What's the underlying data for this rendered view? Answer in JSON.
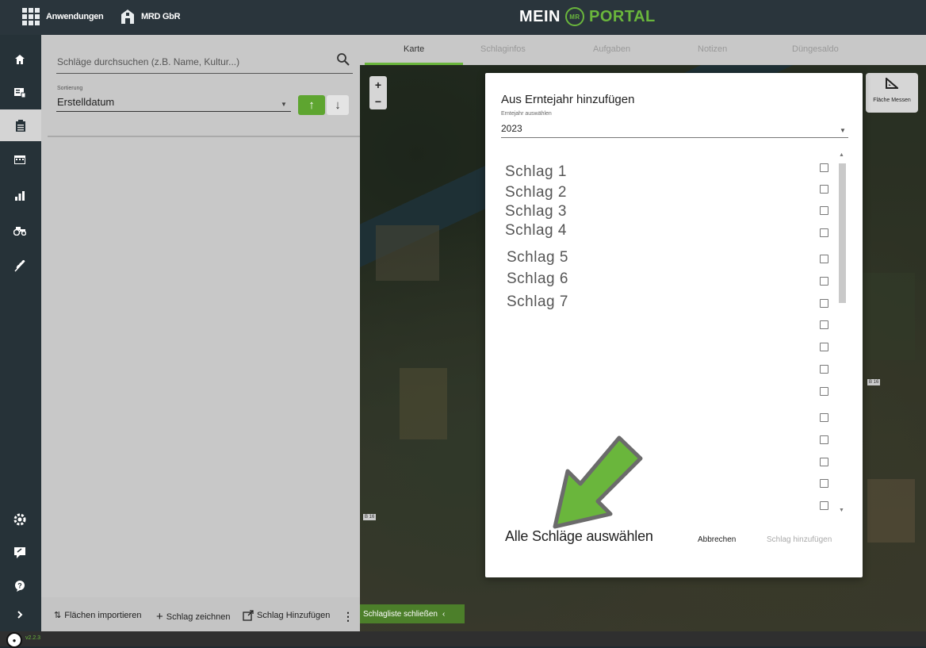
{
  "header": {
    "apps_label": "Anwendungen",
    "org_label": "MRD GbR",
    "brand_left": "MEIN",
    "brand_logo": "MR",
    "brand_right": "PORTAL"
  },
  "sidebar": {
    "icons": [
      "home-icon",
      "map-list-icon",
      "clipboard-icon",
      "calendar-icon",
      "bar-chart-icon",
      "tractor-icon",
      "wheat-icon",
      "settings-icon",
      "feedback-icon",
      "help-icon",
      "expand-icon"
    ]
  },
  "left_panel": {
    "search_placeholder": "Schläge durchsuchen (z.B. Name, Kultur...)",
    "sort_label": "Sortierung",
    "sort_value": "Erstelldatum",
    "sort_asc": "↑",
    "sort_desc": "↓",
    "actions": {
      "import": "Flächen importieren",
      "draw": "Schlag zeichnen",
      "add": "Schlag Hinzufügen"
    }
  },
  "tabs": [
    "Karte",
    "Schlaginfos",
    "Aufgaben",
    "Notizen",
    "Düngesaldo"
  ],
  "map": {
    "zoom_in": "+",
    "zoom_out": "−",
    "measure_label": "Fläche Messen",
    "close_list": "Schlagliste schließen",
    "road_labels": [
      "B 16",
      "B 16"
    ]
  },
  "dialog": {
    "title": "Aus Erntejahr hinzufügen",
    "year_label": "Erntejahr auswählen",
    "year_value": "2023",
    "items": [
      "Schlag 1",
      "Schlag 2",
      "Schlag 3",
      "Schlag 4",
      "Schlag 5",
      "Schlag 6",
      "Schlag 7"
    ],
    "select_all": "Alle Schläge auswählen",
    "cancel": "Abbrechen",
    "add": "Schlag hinzufügen"
  },
  "footer": {
    "version": "v2.2.3"
  },
  "colors": {
    "accent": "#6ab63c",
    "accent_dark": "#5ea530",
    "sidebar": "#263238"
  }
}
